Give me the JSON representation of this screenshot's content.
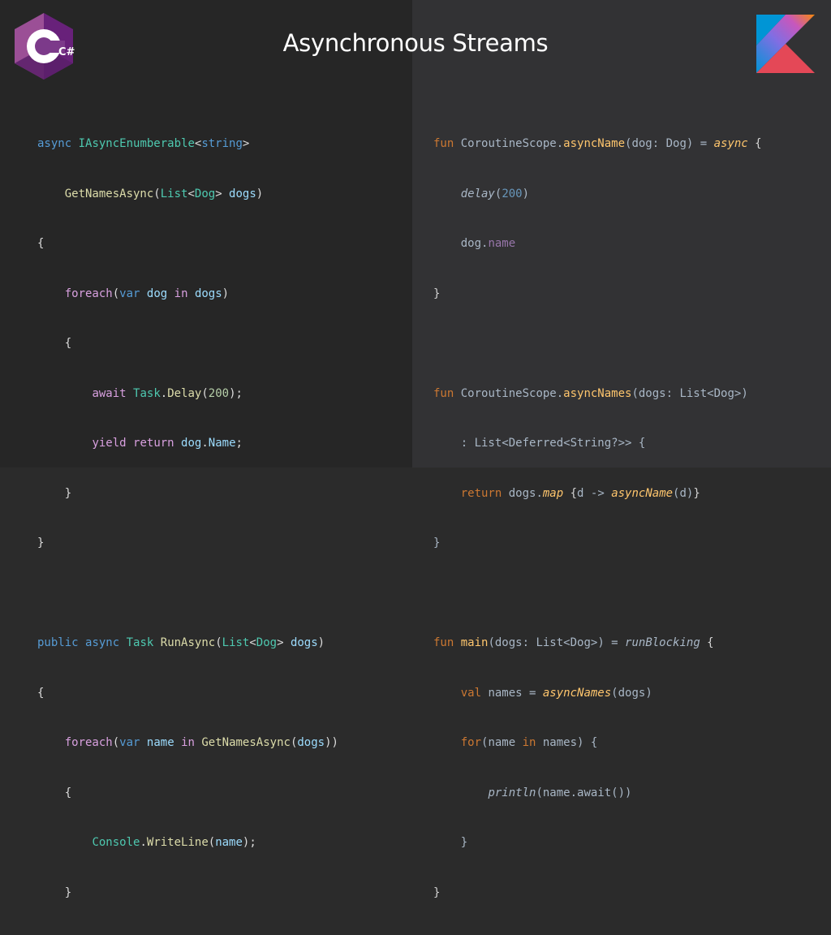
{
  "slide": {
    "title": "Asynchronous Streams"
  },
  "logos": {
    "csharp_text": "C#",
    "colors": {
      "csharp_dark": "#68217a",
      "csharp_light": "#9b4f96",
      "kotlin_blue": "#0095d5",
      "kotlin_purple": "#806ee3",
      "kotlin_orange": "#f88909"
    }
  },
  "csharp": {
    "l1": {
      "a": "async",
      "b": " ",
      "c": "IAsyncEnumberable",
      "d": "<",
      "e": "string",
      "f": ">"
    },
    "l2": {
      "a": "    ",
      "b": "GetNamesAsync",
      "c": "(",
      "d": "List",
      "e": "<",
      "f": "Dog",
      "g": "> ",
      "h": "dogs",
      "i": ")"
    },
    "l3": {
      "a": "{"
    },
    "l4": {
      "a": "    ",
      "b": "foreach",
      "c": "(",
      "d": "var",
      "e": " ",
      "f": "dog",
      "g": " ",
      "h": "in",
      "i": " ",
      "j": "dogs",
      "k": ")"
    },
    "l5": {
      "a": "    {"
    },
    "l6": {
      "a": "        ",
      "b": "await",
      "c": " ",
      "d": "Task",
      "e": ".",
      "f": "Delay",
      "g": "(",
      "h": "200",
      "i": ");"
    },
    "l7": {
      "a": "        ",
      "b": "yield",
      "c": " ",
      "d": "return",
      "e": " ",
      "f": "dog",
      "g": ".",
      "h": "Name",
      "i": ";"
    },
    "l8": {
      "a": "    }"
    },
    "l9": {
      "a": "}"
    },
    "l10": {
      "a": ""
    },
    "l11": {
      "a": "public",
      "b": " ",
      "c": "async",
      "d": " ",
      "e": "Task",
      "f": " ",
      "g": "RunAsync",
      "h": "(",
      "i": "List",
      "j": "<",
      "k": "Dog",
      "l": "> ",
      "m": "dogs",
      "n": ")"
    },
    "l12": {
      "a": "{"
    },
    "l13": {
      "a": "    ",
      "b": "foreach",
      "c": "(",
      "d": "var",
      "e": " ",
      "f": "name",
      "g": " ",
      "h": "in",
      "i": " ",
      "j": "GetNamesAsync",
      "k": "(",
      "l": "dogs",
      "m": "))"
    },
    "l14": {
      "a": "    {"
    },
    "l15": {
      "a": "        ",
      "b": "Console",
      "c": ".",
      "d": "WriteLine",
      "e": "(",
      "f": "name",
      "g": ");"
    },
    "l16": {
      "a": "    }"
    },
    "l17": {
      "a": "}"
    }
  },
  "kotlin": {
    "l1": {
      "a": "fun",
      "b": " CoroutineScope.",
      "c": "asyncName",
      "d": "(dog: Dog) = ",
      "e": "async",
      "f": " {"
    },
    "l2": {
      "a": "    ",
      "b": "delay",
      "c": "(",
      "d": "200",
      "e": ")"
    },
    "l3": {
      "a": "    dog.",
      "b": "name"
    },
    "l4": {
      "a": "}"
    },
    "l5": {
      "a": ""
    },
    "l6": {
      "a": "fun",
      "b": " CoroutineScope.",
      "c": "asyncNames",
      "d": "(dogs: List<Dog>)"
    },
    "l7": {
      "a": "    : List<Deferred<String?>> {"
    },
    "l8": {
      "a": "    ",
      "b": "return",
      "c": " dogs.",
      "d": "map",
      "e": " {",
      "f": "d -> ",
      "g": "asyncName",
      "h": "(d)",
      "i": "}"
    },
    "l9": {
      "a": "}"
    },
    "l10": {
      "a": ""
    },
    "l11": {
      "a": "fun",
      "b": " ",
      "c": "main",
      "d": "(dogs: List<Dog>) = ",
      "e": "runBlocking",
      "f": " {"
    },
    "l12": {
      "a": "    ",
      "b": "val",
      "c": " names = ",
      "d": "asyncNames",
      "e": "(dogs)"
    },
    "l13": {
      "a": "    ",
      "b": "for",
      "c": "(name ",
      "d": "in",
      "e": " names) {"
    },
    "l14": {
      "a": "        ",
      "b": "println",
      "c": "(name.await())"
    },
    "l15": {
      "a": "    }"
    },
    "l16": {
      "a": "}"
    }
  }
}
